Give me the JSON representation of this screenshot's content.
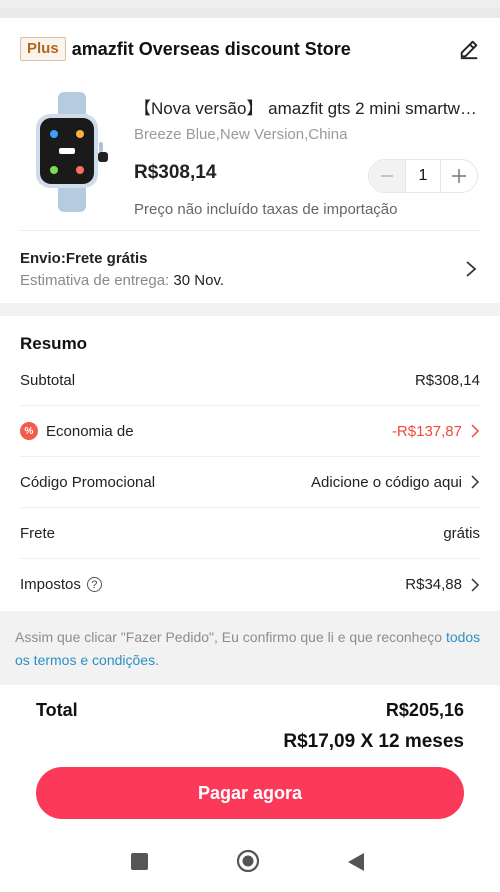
{
  "store": {
    "plus_badge": "Plus",
    "name": "amazfit Overseas discount Store"
  },
  "product": {
    "title": "【Nova versão】 amazfit gts 2 mini smartwatch",
    "variant": "Breeze Blue,New Version,China",
    "price": "R$308,14",
    "quantity": "1",
    "import_note": "Preço não incluído taxas de importação"
  },
  "shipping": {
    "title": "Envio:Frete grátis",
    "estimate_label": "Estimativa de entrega:",
    "estimate_date": "30 Nov."
  },
  "summary": {
    "title": "Resumo",
    "rows": [
      {
        "label": "Subtotal",
        "value": "R$308,14"
      },
      {
        "label": "Economia de",
        "value": "-R$137,87"
      },
      {
        "label": "Código Promocional",
        "value": "Adicione o código aqui"
      },
      {
        "label": "Frete",
        "value": "grátis"
      },
      {
        "label": "Impostos",
        "value": "R$34,88"
      }
    ]
  },
  "terms": {
    "text": "Assim que clicar \"Fazer Pedido\", Eu confirmo que li e que reconheço ",
    "link": "todos os termos e condições."
  },
  "checkout": {
    "total_label": "Total",
    "total_value": "R$205,16",
    "installments": "R$17,09 X 12 meses",
    "pay_button": "Pagar agora"
  },
  "colors": {
    "accent": "#fb3a5a",
    "discount": "#f04a38",
    "link": "#2b8fc5"
  },
  "icons": {
    "edit": "edit-icon",
    "chevron": "chevron-right-icon",
    "discount": "discount-icon",
    "help": "help-icon",
    "nav": [
      "recent-apps-icon",
      "home-icon",
      "back-icon"
    ]
  }
}
